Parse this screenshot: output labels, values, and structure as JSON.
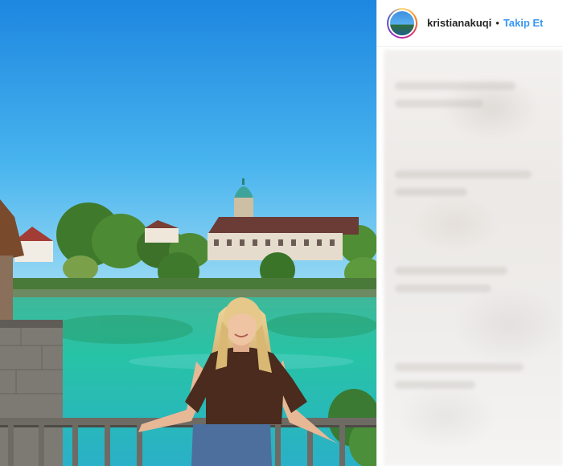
{
  "post": {
    "username": "kristianakuqi",
    "separator": "•",
    "follow_label": "Takip Et"
  },
  "colors": {
    "follow_blue": "#3897f0",
    "sky": "#2aa3e8",
    "water": "#27c3a6"
  },
  "icons": {
    "avatar": "profile-photo-ring"
  }
}
